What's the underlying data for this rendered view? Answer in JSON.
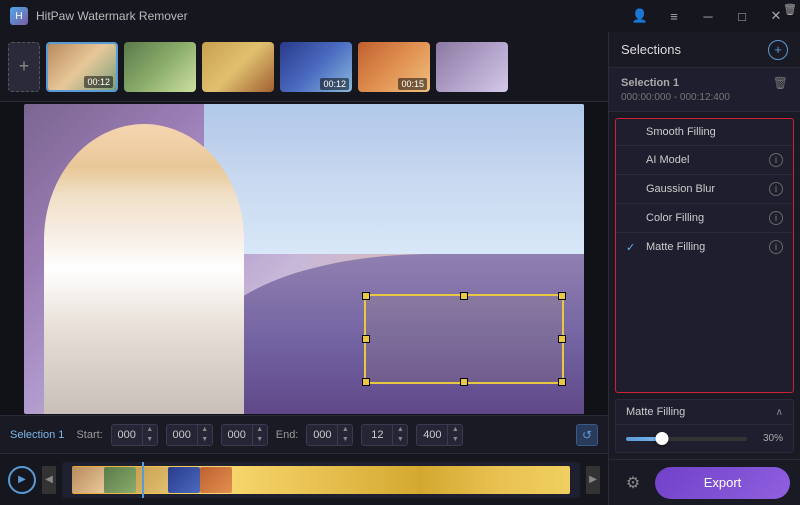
{
  "app": {
    "title": "HitPaw Watermark Remover"
  },
  "titlebar": {
    "buttons": {
      "account": "👤",
      "menu": "≡",
      "minimize": "─",
      "maximize": "□",
      "close": "✕"
    }
  },
  "thumbnails": [
    {
      "id": 1,
      "time": "00:12",
      "selected": true
    },
    {
      "id": 2,
      "time": "",
      "selected": false
    },
    {
      "id": 3,
      "time": "",
      "selected": false
    },
    {
      "id": 4,
      "time": "00:12",
      "selected": false
    },
    {
      "id": 5,
      "time": "00:15",
      "selected": false
    },
    {
      "id": 6,
      "time": "",
      "selected": false
    }
  ],
  "controls": {
    "selection_label": "Selection 1",
    "start_label": "Start:",
    "start_values": [
      "000",
      "000",
      "000"
    ],
    "end_label": "End:",
    "end_values": [
      "000",
      "12",
      "400"
    ]
  },
  "right_panel": {
    "title": "Selections",
    "selection_item": {
      "name": "Selection 1",
      "time_range": "000:00:000 - 000:12:400"
    }
  },
  "options": [
    {
      "label": "Smooth Filling",
      "checked": false,
      "has_info": false
    },
    {
      "label": "AI Model",
      "checked": false,
      "has_info": true
    },
    {
      "label": "Gaussion Blur",
      "checked": false,
      "has_info": true
    },
    {
      "label": "Color Filling",
      "checked": false,
      "has_info": true
    },
    {
      "label": "Matte Filling",
      "checked": true,
      "has_info": true
    }
  ],
  "matte_section": {
    "label": "Matte Filling",
    "slider_percent": "30%",
    "slider_value": 30
  },
  "bottom_actions": {
    "settings_icon": "⚙",
    "export_label": "Export"
  }
}
